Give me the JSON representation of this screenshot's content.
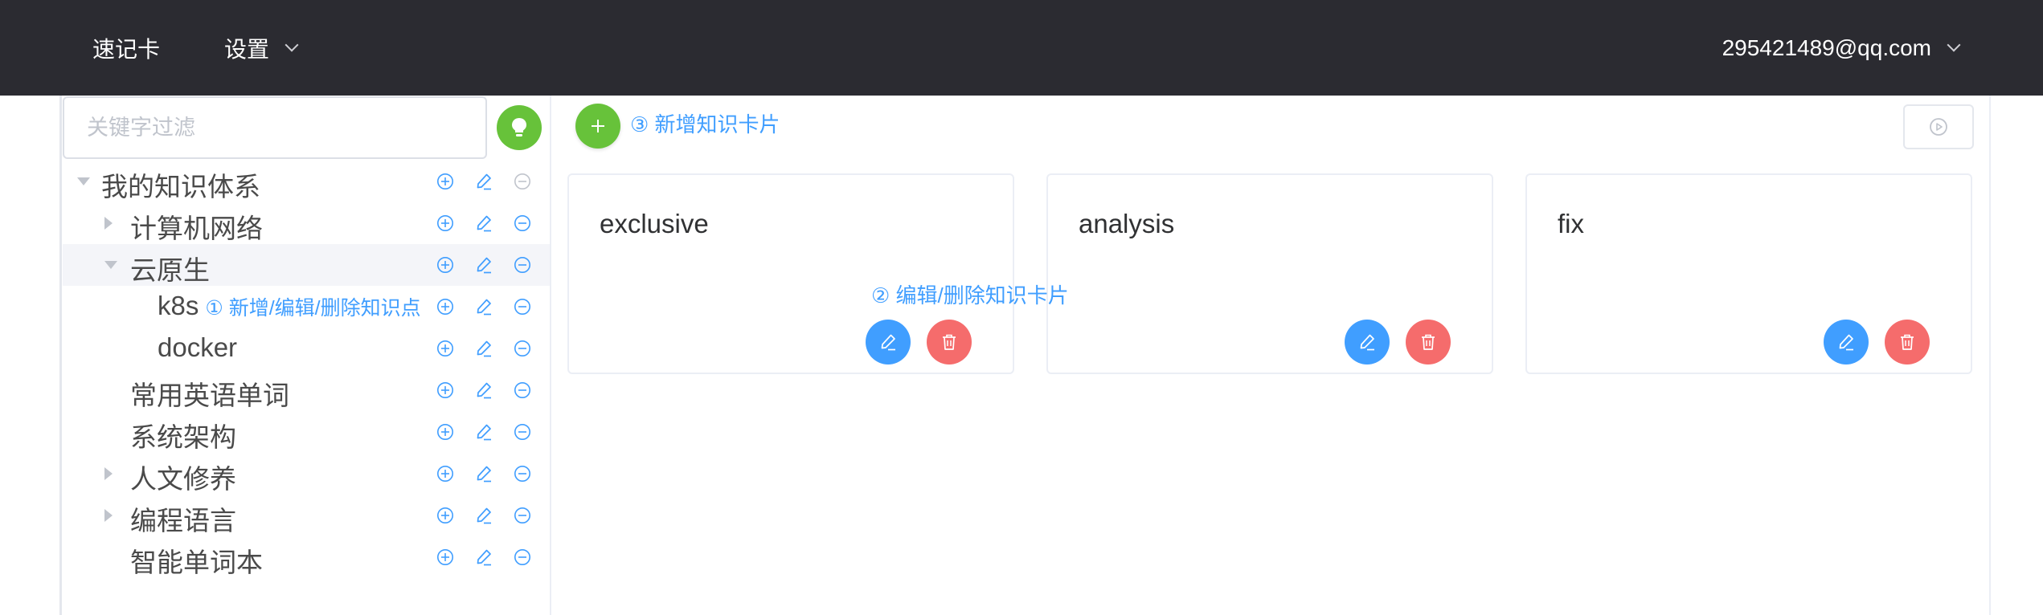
{
  "nav": {
    "brand": "速记卡",
    "settings": "设置",
    "user": "295421489@qq.com"
  },
  "sidebar": {
    "filter_placeholder": "关键字过滤",
    "tree": [
      {
        "label": "我的知识体系",
        "level": 0,
        "caret": "down"
      },
      {
        "label": "计算机网络",
        "level": 1,
        "caret": "right"
      },
      {
        "label": "云原生",
        "level": 1,
        "caret": "down",
        "active": true
      },
      {
        "label": "k8s",
        "level": 2,
        "caret": "none",
        "hint": "① 新增/编辑/删除知识点"
      },
      {
        "label": "docker",
        "level": 2,
        "caret": "none"
      },
      {
        "label": "常用英语单词",
        "level": 1,
        "caret": "none"
      },
      {
        "label": "系统架构",
        "level": 1,
        "caret": "none"
      },
      {
        "label": "人文修养",
        "level": 1,
        "caret": "right"
      },
      {
        "label": "编程语言",
        "level": 1,
        "caret": "right"
      },
      {
        "label": "智能单词本",
        "level": 1,
        "caret": "none"
      }
    ]
  },
  "main": {
    "add_hint": "③ 新增知识卡片",
    "cards_hint": "② 编辑/删除知识卡片",
    "cards": [
      {
        "title": "exclusive"
      },
      {
        "title": "analysis"
      },
      {
        "title": "fix"
      }
    ]
  },
  "icons": {
    "bulb": "lightbulb-icon",
    "plus": "plus-icon",
    "play": "play-circle-icon",
    "edit": "edit-icon",
    "delete": "trash-icon",
    "add_node": "plus-circle-icon",
    "remove_node": "minus-circle-icon"
  },
  "colors": {
    "nav_bg": "#2b2b31",
    "primary": "#409eff",
    "success": "#67c23a",
    "danger": "#f56c6c"
  }
}
